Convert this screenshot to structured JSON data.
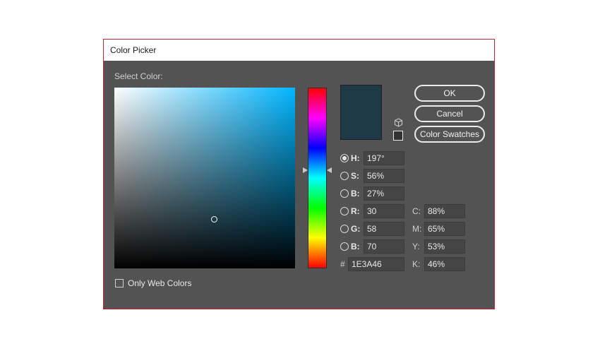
{
  "window": {
    "title": "Color Picker"
  },
  "select_label": "Select Color:",
  "current_color": "#1e3a46",
  "buttons": {
    "ok": "OK",
    "cancel": "Cancel",
    "swatches": "Color Swatches"
  },
  "fields": {
    "h": {
      "label": "H:",
      "value": "197°",
      "selected": true
    },
    "s": {
      "label": "S:",
      "value": "56%"
    },
    "b_hsb": {
      "label": "B:",
      "value": "27%"
    },
    "r": {
      "label": "R:",
      "value": "30"
    },
    "g": {
      "label": "G:",
      "value": "58"
    },
    "b_rgb": {
      "label": "B:",
      "value": "70"
    },
    "hex": {
      "label": "#",
      "value": "1E3A46"
    },
    "c": {
      "label": "C:",
      "value": "88%"
    },
    "m": {
      "label": "M:",
      "value": "65%"
    },
    "y": {
      "label": "Y:",
      "value": "53%"
    },
    "k": {
      "label": "K:",
      "value": "46%"
    }
  },
  "only_web_colors": {
    "label": "Only Web Colors",
    "checked": false
  },
  "icons": {
    "cube": "cube-icon"
  }
}
